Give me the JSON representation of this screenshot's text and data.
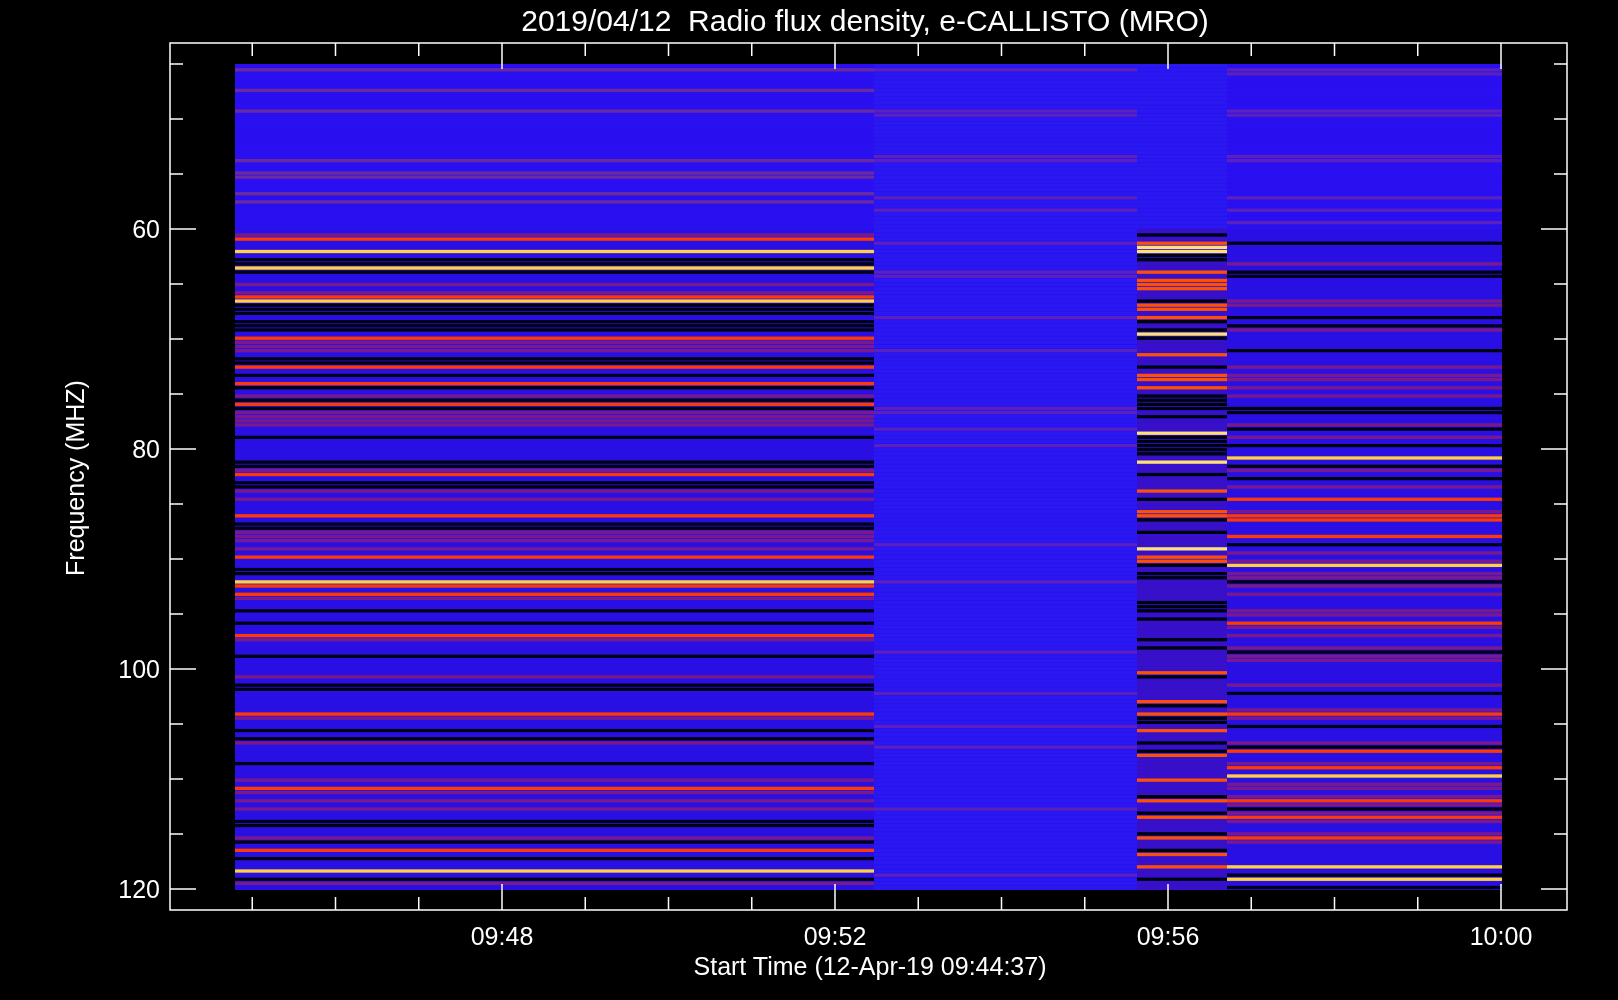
{
  "title": "2019/04/12  Radio flux density, e-CALLISTO (MRO)",
  "y_axis": {
    "label": "Frequency (MHZ)",
    "tick_labels": [
      "60",
      "80",
      "100",
      "120"
    ]
  },
  "x_axis": {
    "label": "Start Time (12-Apr-19 09:44:37)",
    "tick_labels": [
      "09:48",
      "09:52",
      "09:56",
      "10:00"
    ]
  }
}
